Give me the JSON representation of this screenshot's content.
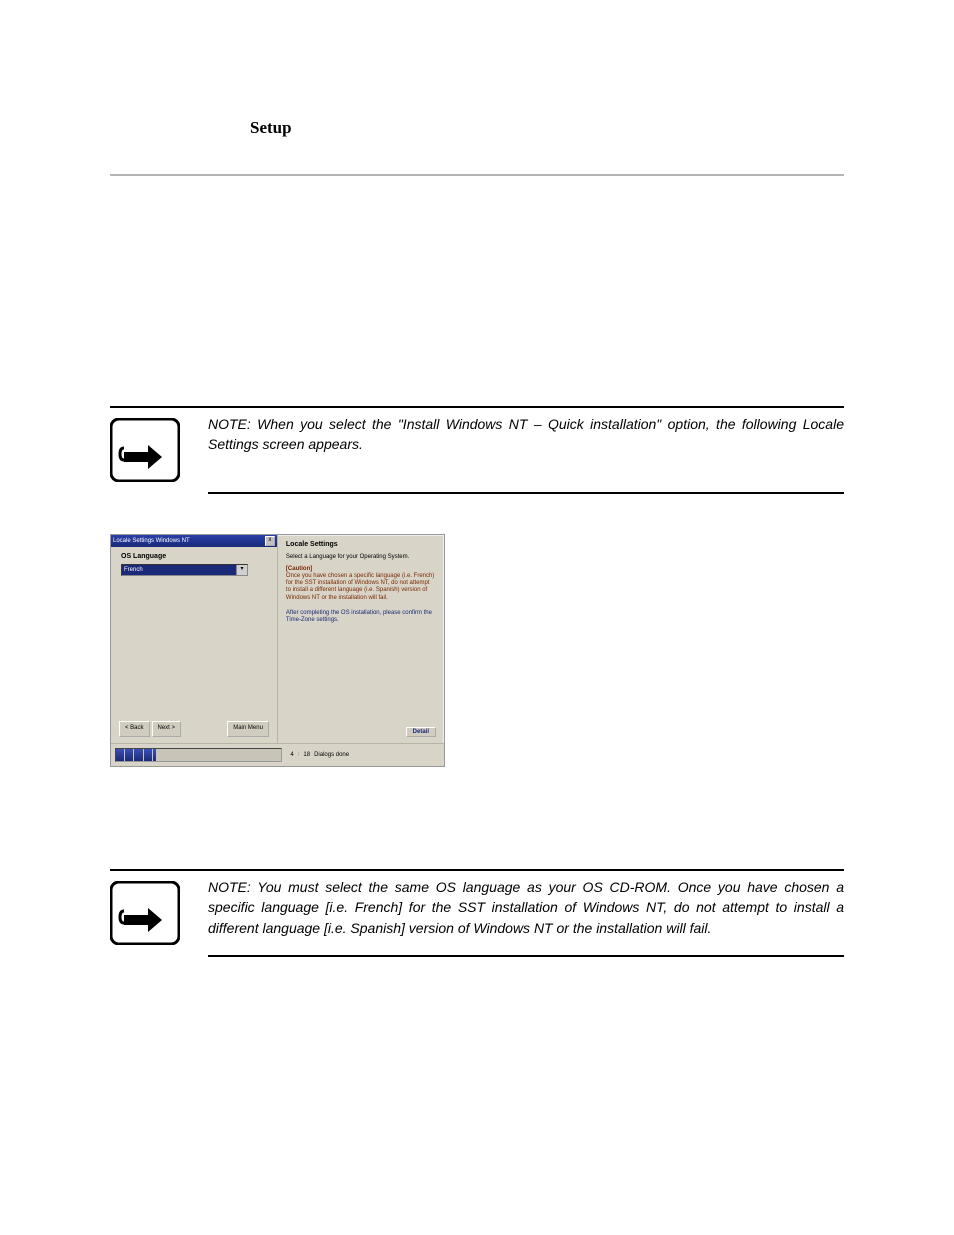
{
  "header": {
    "title": "Setup"
  },
  "note1": {
    "text": "NOTE: When you select the \"Install Windows NT – Quick installation\" option, the following Locale Settings screen appears."
  },
  "note2": {
    "text": "NOTE: You must select the same OS language as your OS CD-ROM. Once you have chosen a specific language [i.e. French] for the SST installation of Windows NT, do not attempt to install a different language [i.e. Spanish] version of Windows NT or the installation will fail."
  },
  "screenshot": {
    "titlebar": "Locale Settings Windows NT",
    "close": "x",
    "left": {
      "label": "OS Language",
      "selected": "French",
      "buttons": {
        "back": "< Back",
        "next": "Next >",
        "main": "Main Menu"
      }
    },
    "right": {
      "heading": "Locale Settings",
      "p1": "Select a Language for your Operating System.",
      "caution_label": "[Caution]",
      "caution_text": "Once you have chosen a specific language (i.e. French) for the SST installation of Windows NT, do not attempt to install a different language (i.e. Spanish) version of Windows NT or the installation will fail.",
      "p2": "After completing the OS installation, please confirm the Time-Zone settings.",
      "detail": "Detail"
    },
    "status": {
      "current": "4",
      "sep": "/",
      "total": "18",
      "label": "Dialogs done"
    }
  }
}
